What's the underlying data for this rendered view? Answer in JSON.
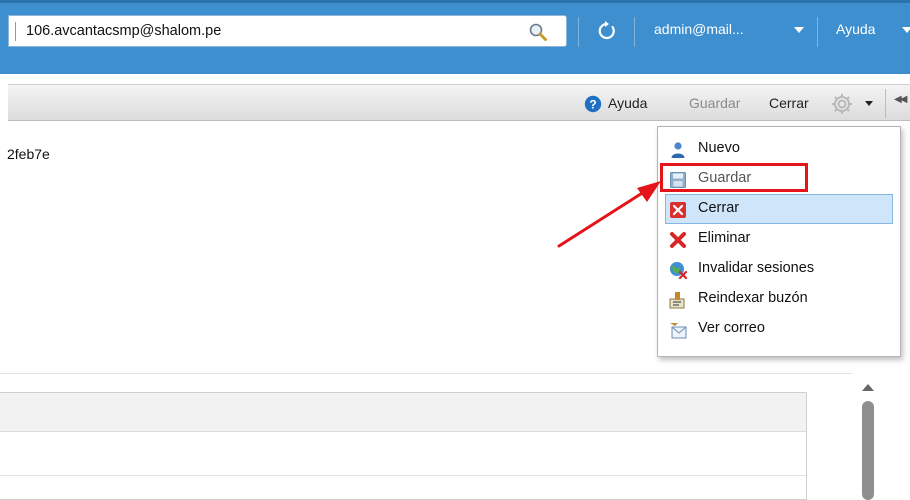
{
  "header": {
    "search_value": "106.avcantacsmp@shalom.pe",
    "user_label": "admin@mail...",
    "help_label": "Ayuda"
  },
  "toolbar": {
    "help_label": "Ayuda",
    "save_label": "Guardar",
    "close_label": "Cerrar"
  },
  "content": {
    "id_fragment": "2feb7e"
  },
  "menu": {
    "items": [
      {
        "label": "Nuevo",
        "icon": "user-icon"
      },
      {
        "label": "Guardar",
        "icon": "save-icon"
      },
      {
        "label": "Cerrar",
        "icon": "close-icon"
      },
      {
        "label": "Eliminar",
        "icon": "delete-icon"
      },
      {
        "label": "Invalidar sesiones",
        "icon": "globe-icon"
      },
      {
        "label": "Reindexar buzón",
        "icon": "reindex-icon"
      },
      {
        "label": "Ver correo",
        "icon": "mail-icon"
      }
    ]
  },
  "colors": {
    "header_blue": "#3d8fcf",
    "highlight_red": "#e4141b",
    "menu_active": "#cfe5fa"
  }
}
